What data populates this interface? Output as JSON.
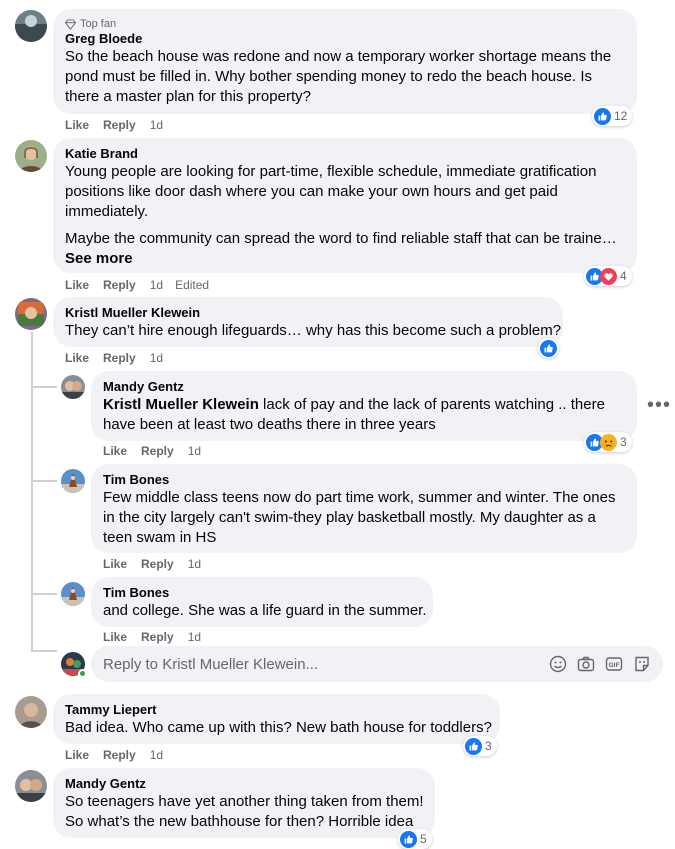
{
  "comments": [
    {
      "name": "Greg Bloede",
      "badge": "Top fan",
      "text": "So the beach house was redone and now a temporary worker shortage means the pond must be filled in. Why bother spending money to redo the beach house. Is there a master plan for this property?",
      "like": "Like",
      "reply": "Reply",
      "time": "1d",
      "reaction_count": "12"
    },
    {
      "name": "Katie Brand",
      "text": "Young people are looking for part-time, flexible schedule, immediate gratification positions like door dash where you can make your own hours and get paid immediately.",
      "text2": "Maybe the community can spread the word to find reliable staff that can be traine…",
      "see_more": "See more",
      "like": "Like",
      "reply": "Reply",
      "time": "1d",
      "edited": "Edited",
      "reaction_count": "4"
    },
    {
      "name": "Kristl Mueller Klewein",
      "text": "They can’t hire enough lifeguards… why has this become such a problem?",
      "like": "Like",
      "reply": "Reply",
      "time": "1d"
    },
    {
      "name": "Tammy Liepert",
      "text": "Bad idea. Who came up with this? New bath house for toddlers?",
      "like": "Like",
      "reply": "Reply",
      "time": "1d",
      "reaction_count": "3"
    },
    {
      "name": "Mandy Gentz",
      "text": "So teenagers have yet another thing taken from them! So what’s the new bathhouse for then? Horrible idea",
      "reaction_count": "5"
    }
  ],
  "replies": [
    {
      "name": "Mandy Gentz",
      "mention": "Kristl Mueller Klewein",
      "text": " lack of pay and the lack of parents watching .. there have been at least two deaths there in three years",
      "like": "Like",
      "reply": "Reply",
      "time": "1d",
      "reaction_count": "3"
    },
    {
      "name": "Tim Bones",
      "text": "Few middle class teens now do part time work, summer and winter. The ones in the city largely can't swim-they play basketball mostly. My daughter as a teen swam in HS",
      "like": "Like",
      "reply": "Reply",
      "time": "1d"
    },
    {
      "name": "Tim Bones",
      "text": "and college. She was a life guard in the summer.",
      "like": "Like",
      "reply": "Reply",
      "time": "1d"
    }
  ],
  "reply_box": {
    "placeholder": "Reply to Kristl Mueller Klewein..."
  },
  "colors": {
    "bubble": "#f0f2f5",
    "like_blue": "#1877f2",
    "love_red": "#f33e58",
    "sad_yellow": "#f7b125",
    "meta_gray": "#65676b"
  },
  "icons": [
    "like-icon",
    "love-icon",
    "sad-icon",
    "emoji-icon",
    "camera-icon",
    "gif-icon",
    "sticker-icon",
    "more-options-icon",
    "diamond-badge-icon"
  ]
}
